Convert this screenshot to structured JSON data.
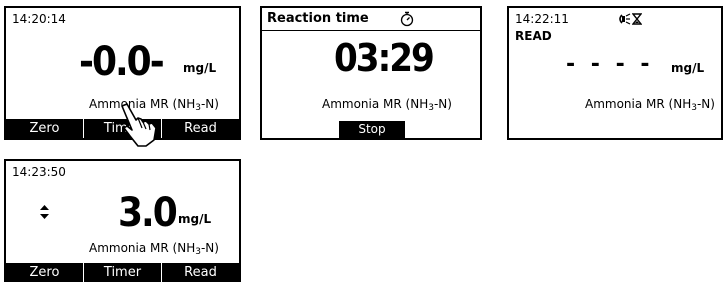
{
  "screen1": {
    "time": "14:20:14",
    "value": "-0.0-",
    "unit": "mg/L",
    "parameter_prefix": "Ammonia MR (NH",
    "parameter_sub": "3",
    "parameter_suffix": "-N)",
    "softkeys": [
      "Zero",
      "Timer",
      "Read"
    ]
  },
  "screen2": {
    "title": "Reaction time",
    "timer_icon": "stopwatch-icon",
    "countdown": "03:29",
    "parameter_prefix": "Ammonia MR (NH",
    "parameter_sub": "3",
    "parameter_suffix": "-N)",
    "stop_label": "Stop"
  },
  "screen3": {
    "time": "14:22:11",
    "status_icons": [
      "lamp-icon",
      "hourglass-icon"
    ],
    "status": "READ",
    "value": "- - - -",
    "unit": "mg/L",
    "parameter_prefix": "Ammonia MR (NH",
    "parameter_sub": "3",
    "parameter_suffix": "-N)"
  },
  "screen4": {
    "time": "14:23:50",
    "value": "3.0",
    "unit": "mg/L",
    "scroll_icon": "up-down-arrows-icon",
    "parameter_prefix": "Ammonia MR (NH",
    "parameter_sub": "3",
    "parameter_suffix": "-N)",
    "softkeys": [
      "Zero",
      "Timer",
      "Read"
    ]
  }
}
